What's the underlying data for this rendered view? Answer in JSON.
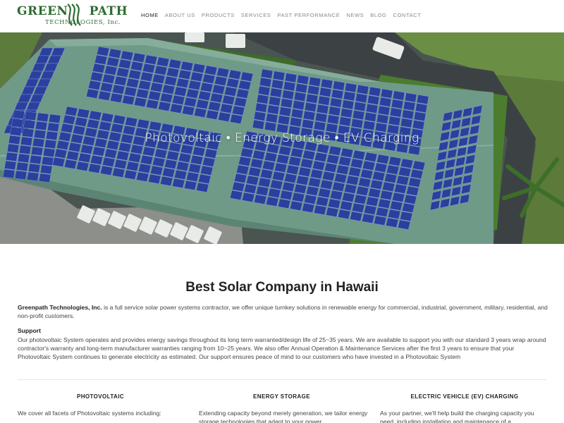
{
  "logo": {
    "word1": "GREEN",
    "word2": "PATH",
    "sub": "TECHNOLOGIES, Inc."
  },
  "nav": {
    "items": [
      {
        "label": "HOME",
        "active": true
      },
      {
        "label": "ABOUT US",
        "active": false
      },
      {
        "label": "PRODUCTS",
        "active": false
      },
      {
        "label": "SERVICES",
        "active": false
      },
      {
        "label": "PAST PERFORMANCE",
        "active": false
      },
      {
        "label": "NEWS",
        "active": false
      },
      {
        "label": "BLOG",
        "active": false
      },
      {
        "label": "CONTACT",
        "active": false
      }
    ]
  },
  "hero": {
    "tagline": "Photovoltaic • Energy Storage • EV Charging"
  },
  "main": {
    "title": "Best Solar Company in Hawaii",
    "intro_company": "Greenpath Technologies, Inc.",
    "intro_text": " is a full service solar power systems contractor, we offer unique turnkey solutions in renewable energy for commercial, industrial, government, military, residential, and non-profit customers.",
    "support_heading": "Support",
    "support_text": "Our photovoltaic System operates and provides energy savings throughout its long term warranted/design life of 25~35 years. We are available to support you with our standard 3 years wrap around contractor's warranty and long-term manufacturer warranties ranging from 10~25 years. We also offer Annual Operation & Maintenance Services after the first 3 years to ensure that your Photovoltaic System continues to generate electricity as estimated. Our support ensures peace of mind to our customers who have invested in a Photovoltaic System"
  },
  "columns": [
    {
      "heading": "PHOTOVOLTAIC",
      "text": "We cover all facets of Photovoltaic systems including:"
    },
    {
      "heading": "ENERGY STORAGE",
      "text": "Extending capacity beyond merely generation, we tailor energy storage technologies that adapt to your power"
    },
    {
      "heading": "ELECTRIC VEHICLE (EV) CHARGING",
      "text": "As your partner, we'll help build the charging capacity you need, including installation and maintenance of a"
    }
  ],
  "colors": {
    "brand_green": "#2e6b32",
    "roof_green": "#6f9a88",
    "panel_blue": "#2a3f9e"
  }
}
